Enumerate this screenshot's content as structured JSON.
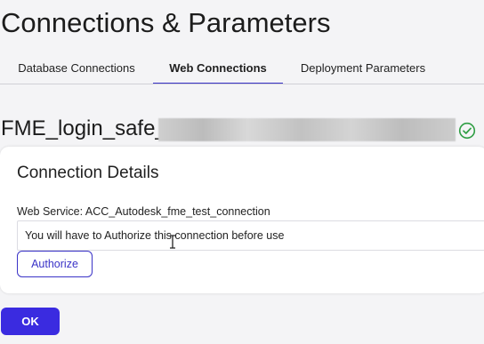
{
  "page": {
    "title": "Connections & Parameters"
  },
  "tabs": [
    {
      "label": "Database Connections"
    },
    {
      "label": "Web Connections",
      "active": true
    },
    {
      "label": "Deployment Parameters"
    }
  ],
  "connection": {
    "name": "FME_login_safe_",
    "status_icon": "check-circle-icon",
    "status_color": "#2f9e44"
  },
  "details": {
    "title": "Connection Details",
    "web_service_label": "Web Service: ACC_Autodesk_fme_test_connection",
    "notice": "You will have to Authorize this connection before use",
    "authorize_label": "Authorize"
  },
  "footer": {
    "ok_label": "OK"
  },
  "colors": {
    "accent": "#3a33c7",
    "ok_button": "#3a2be0"
  }
}
